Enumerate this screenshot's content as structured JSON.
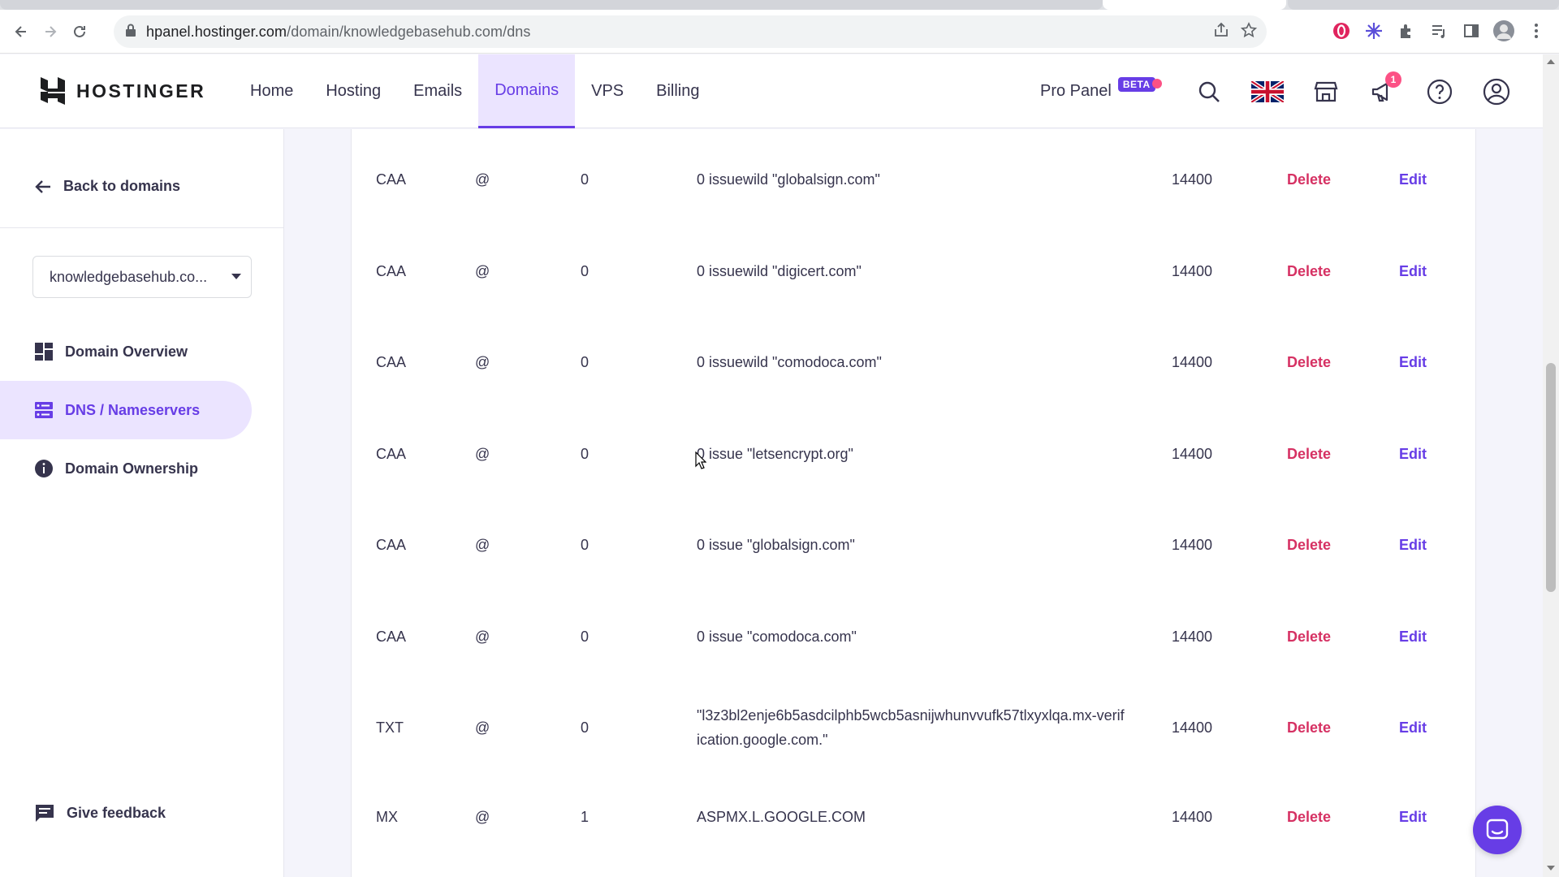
{
  "browser": {
    "url_host": "hpanel.hostinger.com",
    "url_path": "/domain/knowledgebasehub.com/dns"
  },
  "header": {
    "logo_text": "HOSTINGER",
    "nav": [
      {
        "label": "Home"
      },
      {
        "label": "Hosting"
      },
      {
        "label": "Emails"
      },
      {
        "label": "Domains",
        "active": true
      },
      {
        "label": "VPS"
      },
      {
        "label": "Billing"
      }
    ],
    "pro_panel_label": "Pro Panel",
    "beta_label": "BETA",
    "notification_count": "1"
  },
  "sidebar": {
    "back_label": "Back to domains",
    "domain_select_value": "knowledgebasehub.co...",
    "items": [
      {
        "label": "Domain Overview",
        "icon": "dashboard-icon"
      },
      {
        "label": "DNS / Nameservers",
        "icon": "dns-icon",
        "active": true
      },
      {
        "label": "Domain Ownership",
        "icon": "info-icon"
      }
    ],
    "feedback_label": "Give feedback"
  },
  "records": [
    {
      "type": "CAA",
      "name": "@",
      "priority": "0",
      "content": "0 issuewild \"globalsign.com\"",
      "ttl": "14400",
      "delete": "Delete",
      "edit": "Edit"
    },
    {
      "type": "CAA",
      "name": "@",
      "priority": "0",
      "content": "0 issuewild \"digicert.com\"",
      "ttl": "14400",
      "delete": "Delete",
      "edit": "Edit"
    },
    {
      "type": "CAA",
      "name": "@",
      "priority": "0",
      "content": "0 issuewild \"comodoca.com\"",
      "ttl": "14400",
      "delete": "Delete",
      "edit": "Edit"
    },
    {
      "type": "CAA",
      "name": "@",
      "priority": "0",
      "content": "0 issue \"letsencrypt.org\"",
      "ttl": "14400",
      "delete": "Delete",
      "edit": "Edit"
    },
    {
      "type": "CAA",
      "name": "@",
      "priority": "0",
      "content": "0 issue \"globalsign.com\"",
      "ttl": "14400",
      "delete": "Delete",
      "edit": "Edit"
    },
    {
      "type": "CAA",
      "name": "@",
      "priority": "0",
      "content": "0 issue \"comodoca.com\"",
      "ttl": "14400",
      "delete": "Delete",
      "edit": "Edit"
    },
    {
      "type": "TXT",
      "name": "@",
      "priority": "0",
      "content": "\"l3z3bl2enje6b5asdcilphb5wcb5asnijwhunvvufk57tlxyxlqa.mx-verification.google.com.\"",
      "ttl": "14400",
      "delete": "Delete",
      "edit": "Edit"
    },
    {
      "type": "MX",
      "name": "@",
      "priority": "1",
      "content": "ASPMX.L.GOOGLE.COM",
      "ttl": "14400",
      "delete": "Delete",
      "edit": "Edit"
    }
  ],
  "colors": {
    "brand": "#673de6",
    "delete": "#d63163",
    "active_bg": "#ebe4ff"
  }
}
